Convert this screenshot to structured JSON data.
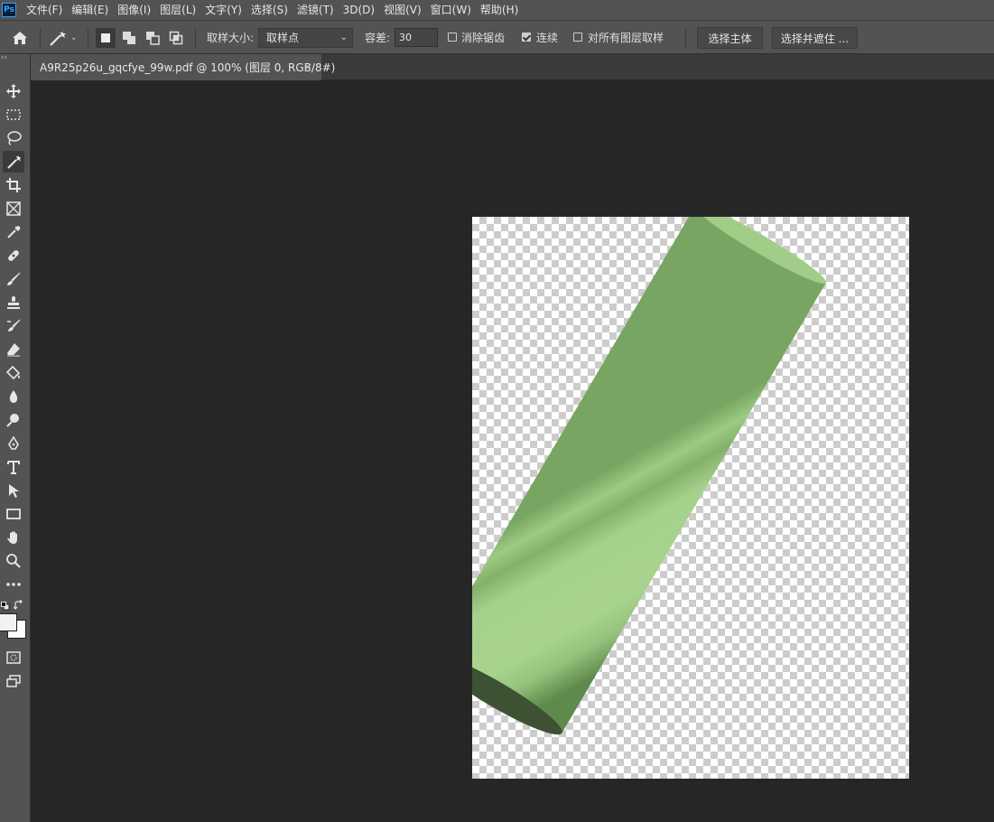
{
  "app": {
    "logo": "Ps"
  },
  "menu": [
    "文件(F)",
    "编辑(E)",
    "图像(I)",
    "图层(L)",
    "文字(Y)",
    "选择(S)",
    "滤镜(T)",
    "3D(D)",
    "视图(V)",
    "窗口(W)",
    "帮助(H)"
  ],
  "options": {
    "sample_size_label": "取样大小:",
    "sample_size_value": "取样点",
    "tolerance_label": "容差:",
    "tolerance_value": "30",
    "anti_alias_label": "消除锯齿",
    "anti_alias_checked": false,
    "contiguous_label": "连续",
    "contiguous_checked": true,
    "sample_all_layers_label": "对所有图层取样",
    "sample_all_layers_checked": false,
    "select_subject_label": "选择主体",
    "select_mask_label": "选择并遮住 ..."
  },
  "document": {
    "tab_title": "A9R25p26u_gqcfye_99w.pdf @ 100% (图层 0, RGB/8#)",
    "close_glyph": "×"
  },
  "colors": {
    "ui_bg": "#535353",
    "canvas_bg": "#262626",
    "cylinder_light": "#a6d18c",
    "cylinder_dark": "#3d5232"
  },
  "icons": [
    "home-icon",
    "magic-wand-icon",
    "move-icon",
    "marquee-icon",
    "lasso-icon",
    "quick-select-icon",
    "crop-icon",
    "frame-icon",
    "eyedropper-icon",
    "healing-brush-icon",
    "brush-icon",
    "stamp-icon",
    "history-brush-icon",
    "eraser-icon",
    "paint-bucket-icon",
    "blur-icon",
    "dodge-icon",
    "pen-icon",
    "type-icon",
    "path-select-icon",
    "rectangle-icon",
    "hand-icon",
    "zoom-icon",
    "more-tools-icon"
  ]
}
